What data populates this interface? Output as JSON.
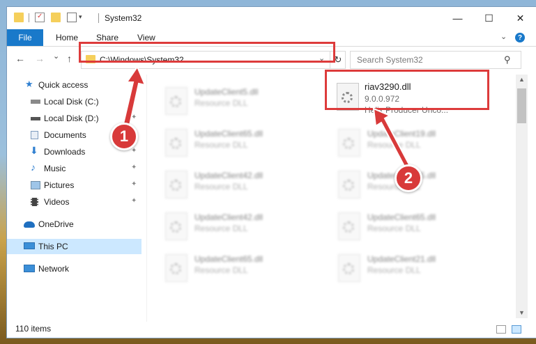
{
  "window": {
    "title": "System32",
    "controls": {
      "minimize": "—",
      "maximize": "☐",
      "close": "✕"
    }
  },
  "ribbon": {
    "file_tab": "File",
    "tabs": [
      "Home",
      "Share",
      "View"
    ],
    "help": "?",
    "expand_chevron": "⌄"
  },
  "nav": {
    "back": "←",
    "forward": "→",
    "recent": "⌄",
    "up": "↑",
    "address": "C:\\Windows\\System32",
    "address_dropdown": "⌄",
    "refresh": "↻",
    "search_placeholder": "Search System32",
    "search_icon": "⚲"
  },
  "sidebar": {
    "items": [
      {
        "label": "Quick access",
        "icon": "star-icon",
        "pinned": false
      },
      {
        "label": "Local Disk (C:)",
        "icon": "drive-icon",
        "pinned": true
      },
      {
        "label": "Local Disk (D:)",
        "icon": "drive-icon",
        "pinned": true
      },
      {
        "label": "Documents",
        "icon": "documents-icon",
        "pinned": true
      },
      {
        "label": "Downloads",
        "icon": "download-icon",
        "pinned": true
      },
      {
        "label": "Music",
        "icon": "music-icon",
        "pinned": true
      },
      {
        "label": "Pictures",
        "icon": "pictures-icon",
        "pinned": true
      },
      {
        "label": "Videos",
        "icon": "videos-icon",
        "pinned": true
      },
      {
        "label": "OneDrive",
        "icon": "cloud-icon",
        "pinned": false
      },
      {
        "label": "This PC",
        "icon": "computer-icon",
        "pinned": false,
        "selected": true
      },
      {
        "label": "Network",
        "icon": "network-icon",
        "pinned": false
      }
    ],
    "pin_glyph": "📌"
  },
  "files": [
    {
      "name": "UpdateClient5.dll",
      "type": "Resource DLL"
    },
    {
      "name": "riav3290.dll",
      "version": "9.0.0.972",
      "description": "Helix Producer Unco..."
    },
    {
      "name": "UpdateClient65.dll",
      "type": "Resource DLL"
    },
    {
      "name": "UpdateClient19.dll",
      "type": "Resource DLL"
    },
    {
      "name": "UpdateClient42.dll",
      "type": "Resource DLL"
    },
    {
      "name": "UpdateClient65.dll",
      "type": "Resource DLL"
    },
    {
      "name": "UpdateClient42.dll",
      "type": "Resource DLL"
    },
    {
      "name": "UpdateClient65.dll",
      "type": "Resource DLL"
    },
    {
      "name": "UpdateClient65.dll",
      "type": "Resource DLL"
    },
    {
      "name": "UpdateClient21.dll",
      "type": "Resource DLL"
    }
  ],
  "status": {
    "item_count": "110 items"
  },
  "callouts": {
    "one": "1",
    "two": "2",
    "color": "#d83a3a"
  }
}
